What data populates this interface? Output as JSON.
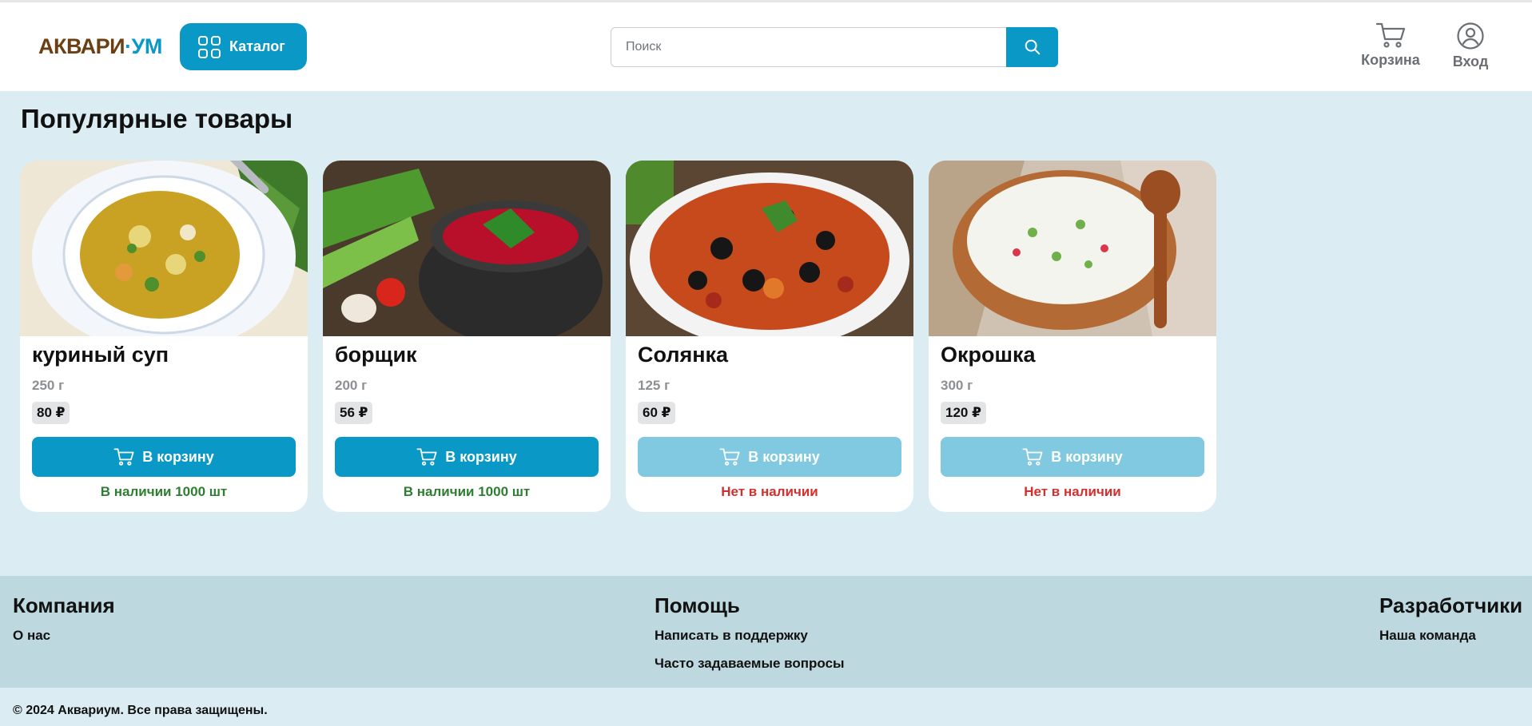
{
  "header": {
    "logo_part1": "АКВАРИ",
    "logo_part2": "·УМ",
    "catalog_label": "Каталог",
    "search_placeholder": "Поиск",
    "cart_label": "Корзина",
    "login_label": "Вход"
  },
  "main": {
    "title": "Популярные товары",
    "products": [
      {
        "name": "куриный суп",
        "weight": "250 г",
        "price": "80 ₽",
        "button": "В корзину",
        "stock": "В наличии 1000 шт",
        "in_stock": true
      },
      {
        "name": "борщик",
        "weight": "200 г",
        "price": "56 ₽",
        "button": "В корзину",
        "stock": "В наличии 1000 шт",
        "in_stock": true
      },
      {
        "name": "Солянка",
        "weight": "125 г",
        "price": "60 ₽",
        "button": "В корзину",
        "stock": "Нет в наличии",
        "in_stock": false
      },
      {
        "name": "Окрошка",
        "weight": "300 г",
        "price": "120 ₽",
        "button": "В корзину",
        "stock": "Нет в наличии",
        "in_stock": false
      }
    ]
  },
  "footer": {
    "company": {
      "title": "Компания",
      "links": [
        "О нас"
      ]
    },
    "help": {
      "title": "Помощь",
      "links": [
        "Написать в поддержку",
        "Часто задаваемые вопросы"
      ]
    },
    "developers": {
      "title": "Разработчики",
      "links": [
        "Наша команда"
      ]
    },
    "copyright": "© 2024 Аквариум. Все права защищены."
  },
  "colors": {
    "accent": "#0a98c6",
    "accent_disabled": "#80c9e0",
    "page_bg": "#dbedf3",
    "footer_bg": "#bed8e0",
    "in_stock": "#2e7d32",
    "out_of_stock": "#d32f2f"
  },
  "icons": [
    "catalog-grid-icon",
    "search-icon",
    "cart-icon",
    "user-icon",
    "cart-button-icon"
  ]
}
